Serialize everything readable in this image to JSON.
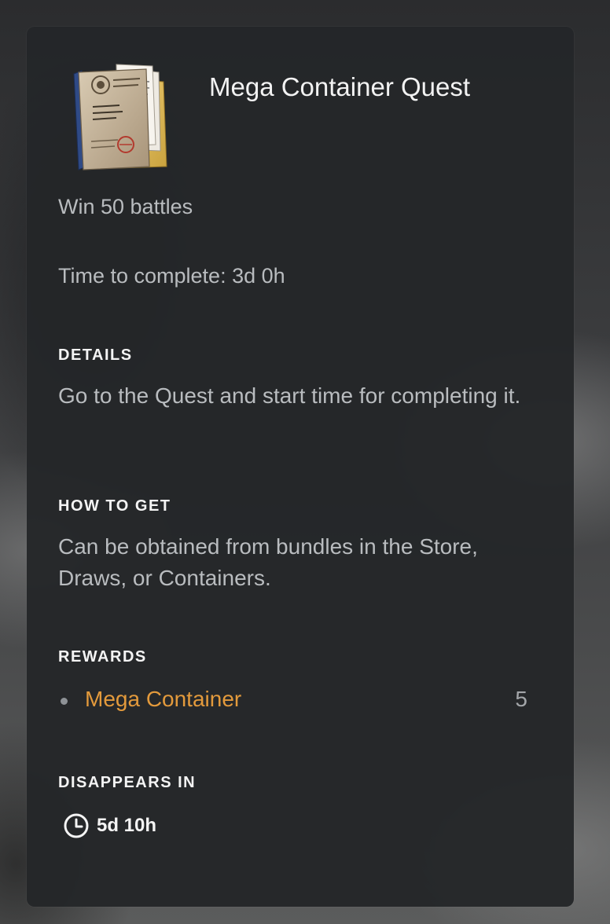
{
  "item": {
    "title": "Mega Container Quest",
    "icon": "quest-documents-icon",
    "objective": "Win 50 battles",
    "time_to_complete": "Time to complete: 3d 0h"
  },
  "details": {
    "heading": "DETAILS",
    "text": "Go to the Quest and start time for completing it."
  },
  "how_to_get": {
    "heading": "HOW TO GET",
    "text": "Can be obtained from bundles in the Store, Draws, or Containers."
  },
  "rewards": {
    "heading": "REWARDS",
    "items": [
      {
        "name": "Mega Container",
        "quantity": "5"
      }
    ]
  },
  "expiry": {
    "heading": "DISAPPEARS IN",
    "icon": "clock-icon",
    "value": "5d 10h"
  },
  "colors": {
    "panel_bg": "#242629",
    "reward_accent": "#e39a3c",
    "body_text": "#b9bcbf",
    "heading_text": "#f4f4f4"
  }
}
